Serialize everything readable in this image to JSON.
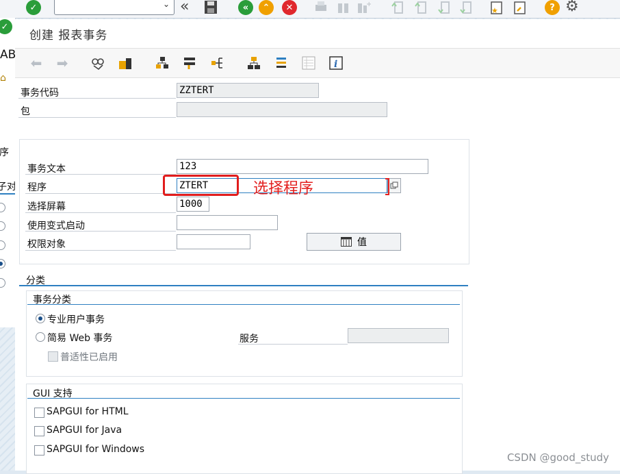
{
  "toolbar": {
    "icons": [
      "check-icon",
      "command-dropdown",
      "back-double-icon",
      "save-icon",
      "back-green-icon",
      "exit-icon",
      "cancel-icon",
      "print-icon",
      "find-icon",
      "find-next-icon",
      "first-page-icon",
      "prev-page-icon",
      "next-page-icon",
      "last-page-icon",
      "new-session-icon",
      "shortcut-icon",
      "help-icon",
      "settings-icon"
    ]
  },
  "left_window": {
    "fragments": [
      "AB",
      "序",
      "子对"
    ]
  },
  "dialog": {
    "title": "创建 报表事务",
    "fields": {
      "tcode_label": "事务代码",
      "tcode_value": "ZZTERT",
      "package_label": "包",
      "package_value": "",
      "text_label": "事务文本",
      "text_value": "123",
      "program_label": "程序",
      "program_value": "ZTERT",
      "screen_label": "选择屏幕",
      "screen_value": "1000",
      "variant_label": "使用变式启动",
      "variant_value": "",
      "auth_label": "权限对象",
      "auth_value": "",
      "value_button": "值"
    },
    "classification": {
      "section_title": "分类",
      "group_title": "事务分类",
      "radio_professional": "专业用户事务",
      "radio_easy_web": "简易 Web 事务",
      "service_label": "服务",
      "service_value": "",
      "pervasive_label": "普适性已启用"
    },
    "gui": {
      "group_title": "GUI 支持",
      "html": "SAPGUI for HTML",
      "java": "SAPGUI for Java",
      "windows": "SAPGUI for Windows"
    }
  },
  "annotation": "选择程序",
  "watermark": "CSDN @good_study",
  "colors": {
    "accent": "#2d7fc1",
    "annotation": "#e3201f",
    "check": "#2a9d3a"
  }
}
